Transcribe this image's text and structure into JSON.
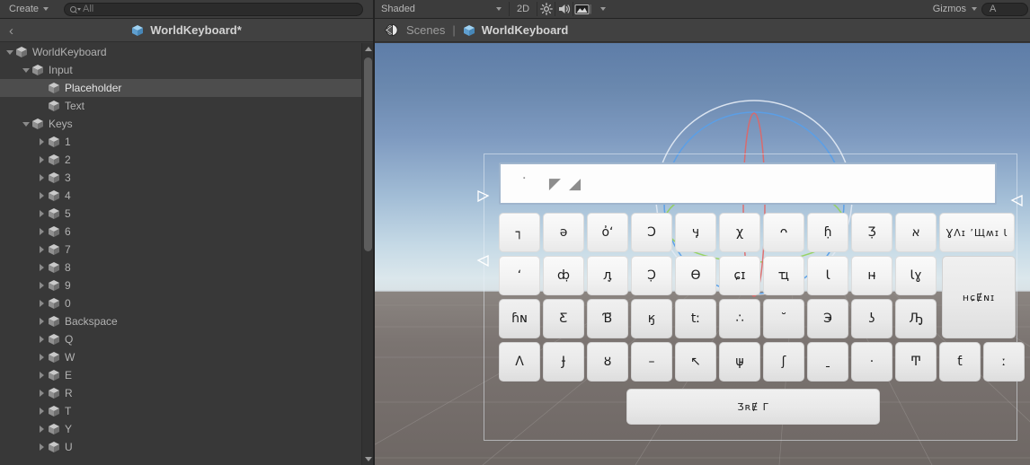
{
  "hierarchy": {
    "toolbar": {
      "create_label": "Create",
      "create_icon": "chevron-down-icon",
      "search_placeholder": "All",
      "search_value": "",
      "search_icon": "search-icon"
    },
    "breadcrumb": {
      "back_icon": "chevron-left-icon",
      "prefab_icon": "prefab-cube-icon",
      "title": "WorldKeyboard*"
    },
    "items": [
      {
        "label": "WorldKeyboard",
        "depth": 0,
        "arrow": "open",
        "icon": "prefab-cube-icon",
        "selected": false
      },
      {
        "label": "Input",
        "depth": 1,
        "arrow": "open",
        "icon": "prefab-cube-icon",
        "selected": false
      },
      {
        "label": "Placeholder",
        "depth": 2,
        "arrow": "none",
        "icon": "prefab-cube-icon",
        "selected": true
      },
      {
        "label": "Text",
        "depth": 2,
        "arrow": "none",
        "icon": "prefab-cube-icon",
        "selected": false
      },
      {
        "label": "Keys",
        "depth": 1,
        "arrow": "open",
        "icon": "prefab-cube-icon",
        "selected": false
      },
      {
        "label": "1",
        "depth": 2,
        "arrow": "closed",
        "icon": "prefab-cube-icon",
        "selected": false
      },
      {
        "label": "2",
        "depth": 2,
        "arrow": "closed",
        "icon": "prefab-cube-icon",
        "selected": false
      },
      {
        "label": "3",
        "depth": 2,
        "arrow": "closed",
        "icon": "prefab-cube-icon",
        "selected": false
      },
      {
        "label": "4",
        "depth": 2,
        "arrow": "closed",
        "icon": "prefab-cube-icon",
        "selected": false
      },
      {
        "label": "5",
        "depth": 2,
        "arrow": "closed",
        "icon": "prefab-cube-icon",
        "selected": false
      },
      {
        "label": "6",
        "depth": 2,
        "arrow": "closed",
        "icon": "prefab-cube-icon",
        "selected": false
      },
      {
        "label": "7",
        "depth": 2,
        "arrow": "closed",
        "icon": "prefab-cube-icon",
        "selected": false
      },
      {
        "label": "8",
        "depth": 2,
        "arrow": "closed",
        "icon": "prefab-cube-icon",
        "selected": false
      },
      {
        "label": "9",
        "depth": 2,
        "arrow": "closed",
        "icon": "prefab-cube-icon",
        "selected": false
      },
      {
        "label": "0",
        "depth": 2,
        "arrow": "closed",
        "icon": "prefab-cube-icon",
        "selected": false
      },
      {
        "label": "Backspace",
        "depth": 2,
        "arrow": "closed",
        "icon": "prefab-cube-icon",
        "selected": false
      },
      {
        "label": "Q",
        "depth": 2,
        "arrow": "closed",
        "icon": "prefab-cube-icon",
        "selected": false
      },
      {
        "label": "W",
        "depth": 2,
        "arrow": "closed",
        "icon": "prefab-cube-icon",
        "selected": false
      },
      {
        "label": "E",
        "depth": 2,
        "arrow": "closed",
        "icon": "prefab-cube-icon",
        "selected": false
      },
      {
        "label": "R",
        "depth": 2,
        "arrow": "closed",
        "icon": "prefab-cube-icon",
        "selected": false
      },
      {
        "label": "T",
        "depth": 2,
        "arrow": "closed",
        "icon": "prefab-cube-icon",
        "selected": false
      },
      {
        "label": "Y",
        "depth": 2,
        "arrow": "closed",
        "icon": "prefab-cube-icon",
        "selected": false
      },
      {
        "label": "U",
        "depth": 2,
        "arrow": "closed",
        "icon": "prefab-cube-icon",
        "selected": false
      }
    ]
  },
  "scene": {
    "toolbar": {
      "draw_mode": "Shaded",
      "draw_mode_icon": "chevron-down-icon",
      "view_2d": "2D",
      "lighting_icon": "sun-icon",
      "audio_icon": "speaker-icon",
      "fx_icon": "image-icon",
      "fx_dropdown_icon": "chevron-down-icon",
      "gizmos_label": "Gizmos",
      "gizmos_icon": "chevron-down-icon",
      "search_icon": "search-icon",
      "search_value": "A",
      "search_placeholder": ""
    },
    "breadcrumb": {
      "back_icon": "back-arrow-icon",
      "scenes_label": "Scenes",
      "separator": "|",
      "prefab_icon": "prefab-cube-icon",
      "title": "WorldKeyboard"
    },
    "colors": {
      "sky_top": "#5e7da8",
      "sky_horizon": "#dbe7ec",
      "ground": "#7b7471",
      "gizmo_x": "#e06666",
      "gizmo_y": "#8fd14f",
      "gizmo_z": "#4a90e2",
      "gizmo_outer": "#dfe8f2",
      "selection_outline": "#e8eef6",
      "key_face": "#f3f3f3",
      "key_border": "#dcdcdc",
      "input_border": "#9fb5cd"
    }
  },
  "keyboard": {
    "input_placeholder": "˙ ◤◢",
    "rows": [
      {
        "name": "row-1",
        "keys": [
          {
            "name": "key-1",
            "glyph": "┐",
            "style": "light",
            "size": "normal"
          },
          {
            "name": "key-2",
            "glyph": "ə",
            "style": "light",
            "size": "normal"
          },
          {
            "name": "key-3",
            "glyph": "ὀʻ",
            "style": "light",
            "size": "normal"
          },
          {
            "name": "key-4",
            "glyph": "Ɔ",
            "style": "light",
            "size": "normal"
          },
          {
            "name": "key-5",
            "glyph": "ӌ",
            "style": "light",
            "size": "normal"
          },
          {
            "name": "key-6",
            "glyph": "χ",
            "style": "light",
            "size": "normal"
          },
          {
            "name": "key-7",
            "glyph": "ᴖ",
            "style": "light",
            "size": "normal"
          },
          {
            "name": "key-8",
            "glyph": "ɦ̣",
            "style": "light",
            "size": "normal"
          },
          {
            "name": "key-9",
            "glyph": "Ʒ̣",
            "style": "light",
            "size": "normal"
          },
          {
            "name": "key-0",
            "glyph": "א",
            "style": "light",
            "size": "normal"
          },
          {
            "name": "key-backspace",
            "glyph": "ƔɅɪ ʼЩʍɪ Ɩ",
            "style": "light",
            "size": "wide"
          }
        ]
      },
      {
        "name": "row-2",
        "keys": [
          {
            "name": "key-q",
            "glyph": "ʻ",
            "style": "light",
            "size": "normal"
          },
          {
            "name": "key-w",
            "glyph": "ȸ̣",
            "style": "light",
            "size": "normal"
          },
          {
            "name": "key-e",
            "glyph": "ӆ̣",
            "style": "light",
            "size": "normal"
          },
          {
            "name": "key-r",
            "glyph": "Ɔ̣",
            "style": "light",
            "size": "normal"
          },
          {
            "name": "key-t",
            "glyph": "Ѳ",
            "style": "light",
            "size": "normal"
          },
          {
            "name": "key-y",
            "glyph": "ɕɪ",
            "style": "light",
            "size": "normal"
          },
          {
            "name": "key-u",
            "glyph": "ҵ",
            "style": "light",
            "size": "normal"
          },
          {
            "name": "key-i",
            "glyph": "Ɩ",
            "style": "light",
            "size": "normal"
          },
          {
            "name": "key-o",
            "glyph": "ʜ̵",
            "style": "light",
            "size": "normal"
          },
          {
            "name": "key-p",
            "glyph": "Ɩɣ",
            "style": "light",
            "size": "normal"
          }
        ]
      },
      {
        "name": "row-3",
        "keys": [
          {
            "name": "key-a",
            "glyph": "ɦɴ",
            "style": "dim",
            "size": "normal"
          },
          {
            "name": "key-s",
            "glyph": "Ƹ",
            "style": "dim",
            "size": "normal"
          },
          {
            "name": "key-d",
            "glyph": "Ɓ̈",
            "style": "dim",
            "size": "normal"
          },
          {
            "name": "key-f",
            "glyph": "ӄ",
            "style": "dim",
            "size": "normal"
          },
          {
            "name": "key-g",
            "glyph": "tː",
            "style": "dim",
            "size": "normal"
          },
          {
            "name": "key-h",
            "glyph": "∴",
            "style": "dim",
            "size": "normal"
          },
          {
            "name": "key-j",
            "glyph": "˘",
            "style": "dim",
            "size": "normal"
          },
          {
            "name": "key-k",
            "glyph": "Э̵",
            "style": "dim",
            "size": "normal"
          },
          {
            "name": "key-l",
            "glyph": "ʖ",
            "style": "dim",
            "size": "normal"
          },
          {
            "name": "key-semicolon",
            "glyph": "Ԡ̣",
            "style": "dim",
            "size": "normal"
          }
        ]
      },
      {
        "name": "row-4",
        "keys": [
          {
            "name": "key-z",
            "glyph": "Ʌ",
            "style": "dim",
            "size": "normal"
          },
          {
            "name": "key-x",
            "glyph": "Ɉ",
            "style": "dim",
            "size": "normal"
          },
          {
            "name": "key-c",
            "glyph": "ȣ",
            "style": "dim",
            "size": "normal"
          },
          {
            "name": "key-v",
            "glyph": "–",
            "style": "dim",
            "size": "normal"
          },
          {
            "name": "key-b",
            "glyph": "↖",
            "style": "dim",
            "size": "normal"
          },
          {
            "name": "key-n",
            "glyph": "ψ̵",
            "style": "dim",
            "size": "normal"
          },
          {
            "name": "key-m",
            "glyph": "ʃ",
            "style": "dim",
            "size": "normal"
          },
          {
            "name": "key-comma",
            "glyph": "ˍ",
            "style": "dim",
            "size": "normal"
          },
          {
            "name": "key-period",
            "glyph": "·",
            "style": "dim",
            "size": "normal"
          },
          {
            "name": "key-slash",
            "glyph": "Ͳ",
            "style": "dim",
            "size": "normal"
          },
          {
            "name": "key-quote",
            "glyph": "ƭ",
            "style": "dim",
            "size": "normal"
          },
          {
            "name": "key-enter2",
            "glyph": "ː",
            "style": "dim",
            "size": "normal"
          }
        ]
      }
    ],
    "enter_key": {
      "name": "key-enter",
      "glyph": "ʜɕɆɴɪ",
      "style": "dim"
    },
    "space_key": {
      "name": "key-space",
      "glyph": "ƷʀɆ Γ",
      "style": "dim"
    }
  }
}
